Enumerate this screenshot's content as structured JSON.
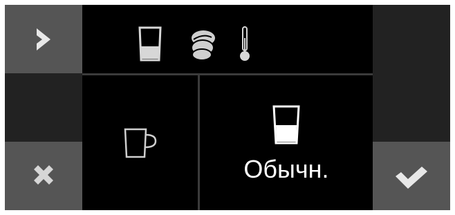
{
  "screen": {
    "top_bar": {
      "icons": [
        "cup-fill-icon",
        "beans-icon",
        "thermometer-icon"
      ]
    },
    "left_column": {
      "forward_button": {
        "icon": "chevron-right-icon"
      },
      "cancel_button": {
        "icon": "close-icon"
      }
    },
    "right_column": {
      "confirm_button": {
        "icon": "checkmark-icon"
      }
    },
    "options": [
      {
        "icon": "coffee-mug-icon",
        "label": ""
      },
      {
        "icon": "cup-fill-icon",
        "label": "Обычн."
      }
    ],
    "colors": {
      "background": "#000000",
      "dark_tile": "#222222",
      "light_tile": "#555555",
      "icon_grey": "#cfcfcf",
      "icon_white": "#ffffff"
    }
  }
}
